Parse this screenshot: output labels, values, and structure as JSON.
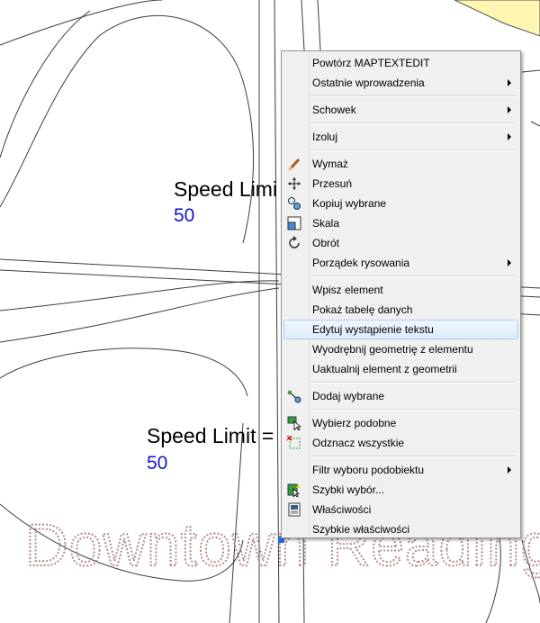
{
  "map": {
    "labels": [
      {
        "text": "Speed Limi",
        "value": "50"
      },
      {
        "text": "Speed Limit =",
        "value": "50"
      }
    ],
    "watermark": "Downtown Reading",
    "colors": {
      "label": "#000000",
      "value": "#1414c8",
      "watermark": "#b48c8c",
      "parcel": "#fff6b4"
    }
  },
  "context_menu": {
    "items": [
      {
        "label": "Powtórz MAPTEXTEDIT"
      },
      {
        "label": "Ostatnie wprowadzenia",
        "submenu": true
      },
      {
        "label": "Schowek",
        "submenu": true
      },
      {
        "label": "Izoluj",
        "submenu": true
      },
      {
        "label": "Wymaż",
        "icon": "eraser-icon"
      },
      {
        "label": "Przesuń",
        "icon": "move-icon"
      },
      {
        "label": "Kopiuj wybrane",
        "icon": "copy-selection-icon"
      },
      {
        "label": "Skala",
        "icon": "scale-icon"
      },
      {
        "label": "Obrót",
        "icon": "rotate-icon"
      },
      {
        "label": "Porządek rysowania",
        "submenu": true
      },
      {
        "label": "Wpisz element"
      },
      {
        "label": "Pokaż tabelę danych"
      },
      {
        "label": "Edytuj wystąpienie tekstu",
        "hovered": true
      },
      {
        "label": "Wyodrębnij geometrię z elementu"
      },
      {
        "label": "Uaktualnij element z geometrii"
      },
      {
        "label": "Dodaj wybrane",
        "icon": "add-selected-icon"
      },
      {
        "label": "Wybierz podobne",
        "icon": "select-similar-icon"
      },
      {
        "label": "Odznacz wszystkie",
        "icon": "deselect-all-icon"
      },
      {
        "label": "Filtr wyboru podobiektu",
        "submenu": true
      },
      {
        "label": "Szybki wybór...",
        "icon": "quick-select-icon"
      },
      {
        "label": "Właściwości",
        "icon": "properties-icon"
      },
      {
        "label": "Szybkie właściwości"
      }
    ]
  }
}
